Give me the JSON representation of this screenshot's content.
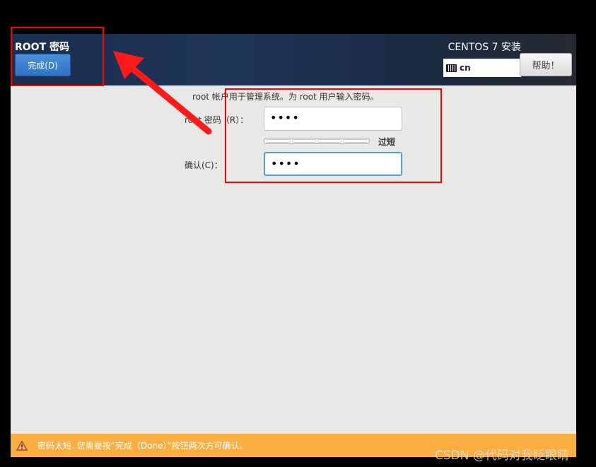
{
  "header": {
    "title": "ROOT 密码",
    "done_label": "完成(D)",
    "product": "CENTOS 7 安装",
    "keyboard_layout": "cn",
    "help_label": "帮助！"
  },
  "form": {
    "description": "root 帐户用于管理系统。为 root 用户输入密码。",
    "password_label": "root 密码（R）：",
    "password_value": "••••",
    "strength_label": "过短",
    "strength_level": 0,
    "confirm_label": "确认(C)：",
    "confirm_value": "••••"
  },
  "warning": {
    "icon": "warning-icon",
    "text": "密码太短. 您需要按“完成（Done）”按钮两次方可确认。"
  },
  "watermark": "CSDN @代码对我眨眼睛",
  "colors": {
    "accent": "#2f73c4",
    "warning": "#fbae40",
    "annotation": "#ff0000"
  }
}
